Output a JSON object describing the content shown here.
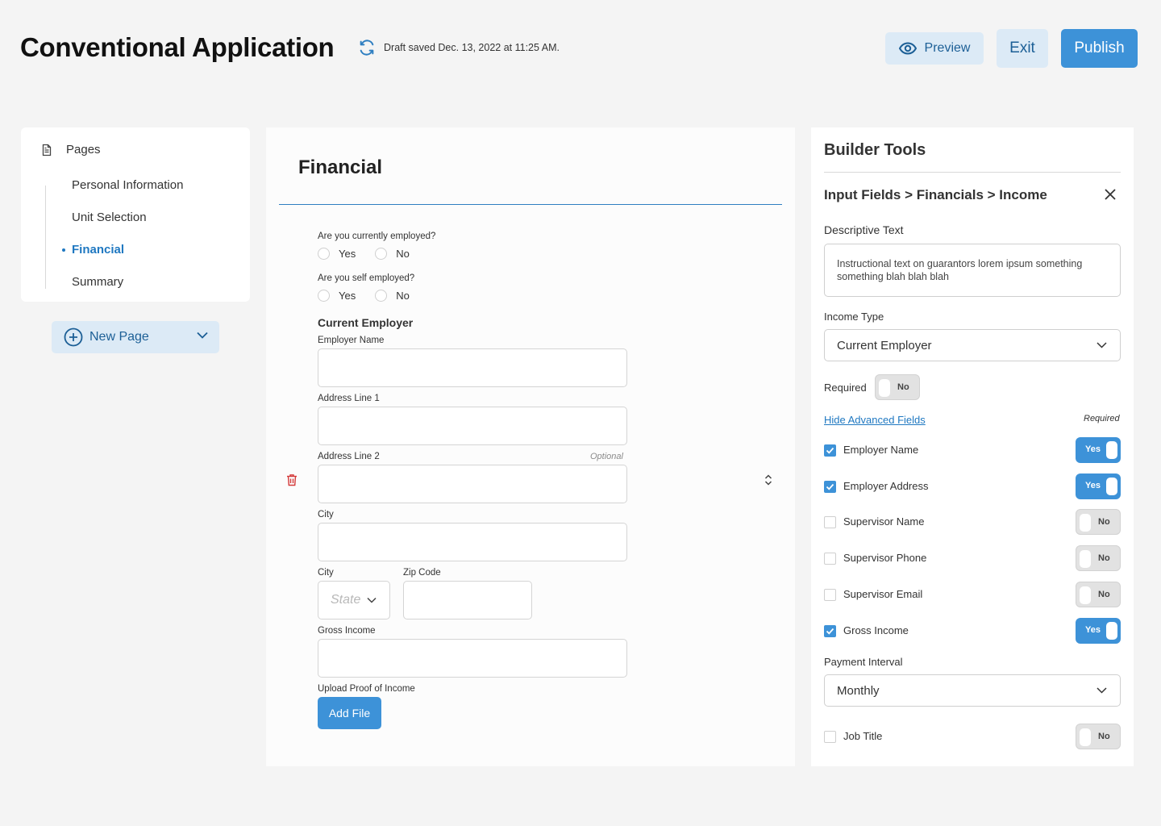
{
  "header": {
    "title": "Conventional Application",
    "draft_status": "Draft saved Dec. 13, 2022 at 11:25 AM.",
    "preview_label": "Preview",
    "exit_label": "Exit",
    "publish_label": "Publish"
  },
  "sidebar": {
    "heading": "Pages",
    "items": [
      {
        "label": "Personal Information",
        "active": false
      },
      {
        "label": "Unit Selection",
        "active": false
      },
      {
        "label": "Financial",
        "active": true
      },
      {
        "label": "Summary",
        "active": false
      }
    ],
    "new_page_label": "New Page"
  },
  "form": {
    "title": "Financial",
    "employed_question": "Are you currently employed?",
    "self_employed_question": "Are you self employed?",
    "yes_label": "Yes",
    "no_label": "No",
    "section_heading": "Current Employer",
    "employer_name_label": "Employer Name",
    "address1_label": "Address Line 1",
    "address2_label": "Address Line 2",
    "optional_label": "Optional",
    "city_label": "City",
    "city2_label": "City",
    "state_placeholder": "State",
    "zip_label": "Zip Code",
    "gross_income_label": "Gross Income",
    "upload_label": "Upload Proof of Income",
    "add_file_label": "Add File"
  },
  "tools": {
    "title": "Builder Tools",
    "breadcrumb": "Input Fields > Financials > Income",
    "descriptive_text_label": "Descriptive Text",
    "descriptive_text_value": "Instructional text on guarantors lorem ipsum something something blah blah blah",
    "income_type_label": "Income Type",
    "income_type_value": "Current Employer",
    "required_label": "Required",
    "required_value": "No",
    "advanced_link": "Hide Advanced Fields",
    "required_column": "Required",
    "fields": [
      {
        "label": "Employer Name",
        "checked": true,
        "required": "Yes"
      },
      {
        "label": "Employer Address",
        "checked": true,
        "required": "Yes"
      },
      {
        "label": "Supervisor Name",
        "checked": false,
        "required": "No"
      },
      {
        "label": "Supervisor Phone",
        "checked": false,
        "required": "No"
      },
      {
        "label": "Supervisor Email",
        "checked": false,
        "required": "No"
      },
      {
        "label": "Gross Income",
        "checked": true,
        "required": "Yes"
      }
    ],
    "payment_interval_label": "Payment Interval",
    "payment_interval_value": "Monthly",
    "job_title": {
      "label": "Job Title",
      "checked": false,
      "required": "No"
    }
  },
  "colors": {
    "accent": "#3d92d8",
    "accent_light": "#dceaf6",
    "active_link": "#1f78c1",
    "delete_icon": "#d43a3a"
  },
  "icons": [
    "sync-icon",
    "eye-icon",
    "document-icon",
    "plus-circle-icon",
    "chevron-down-icon",
    "trash-icon",
    "sort-arrows-icon",
    "close-icon",
    "checkmark-icon"
  ]
}
